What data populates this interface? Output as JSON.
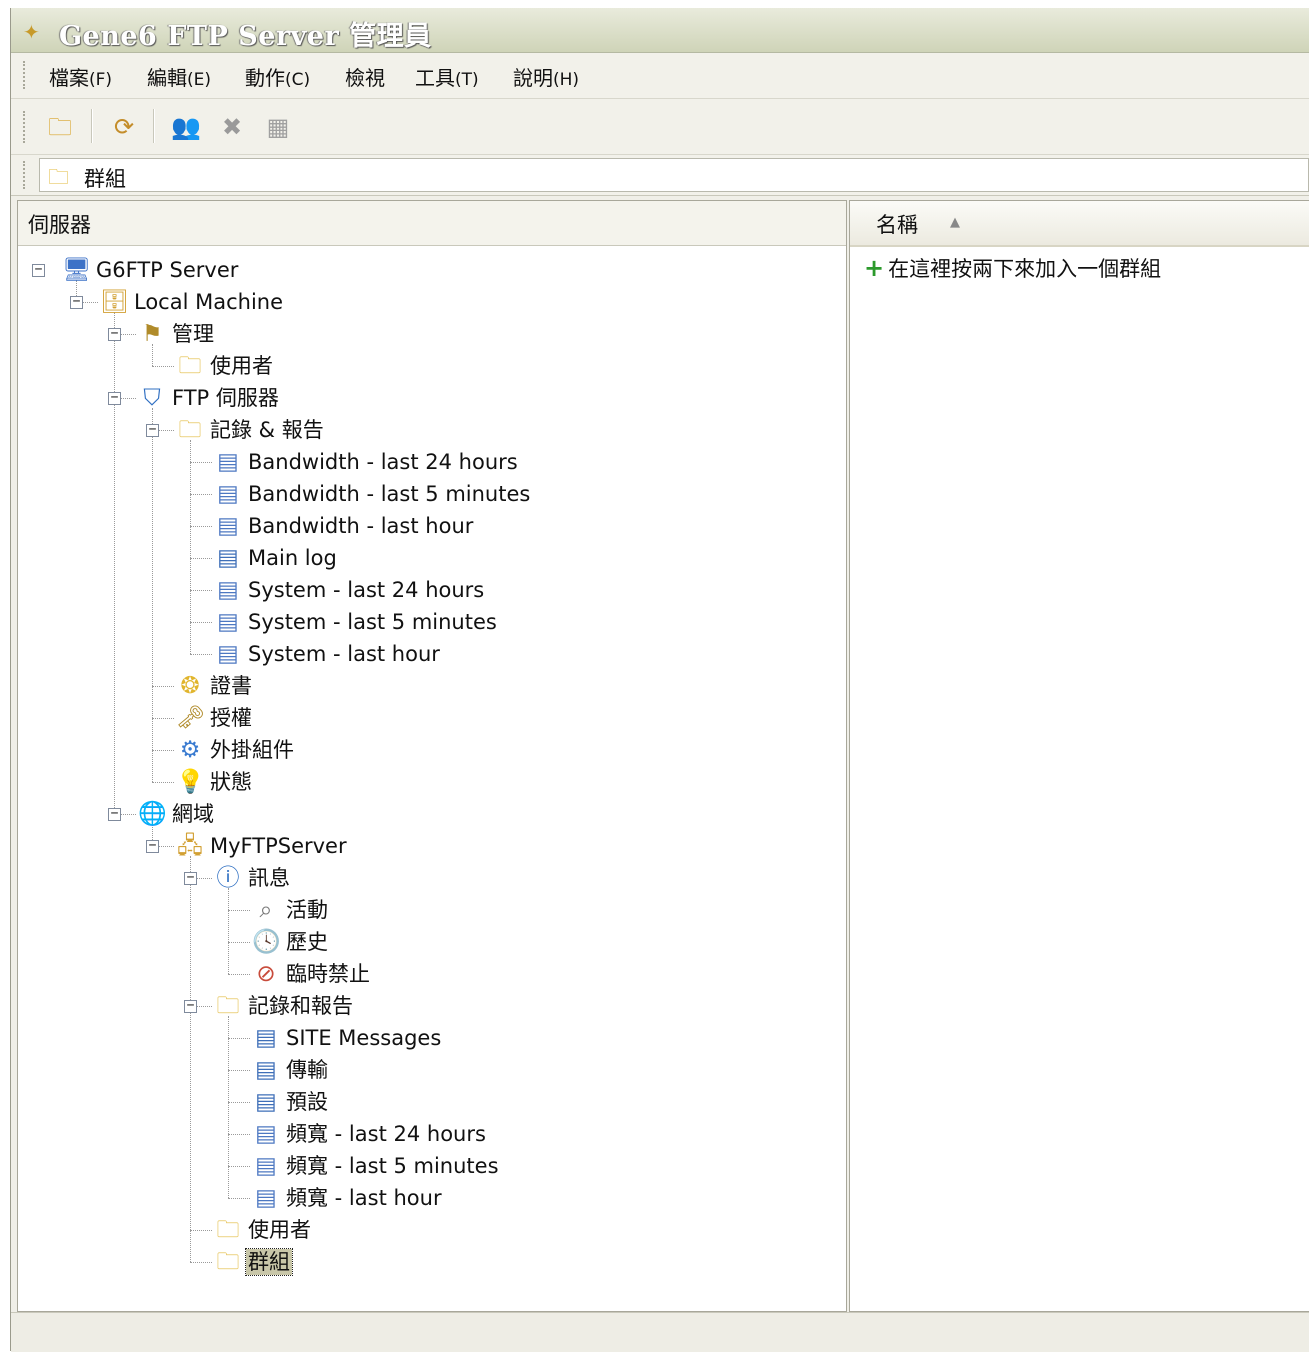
{
  "window": {
    "title": "Gene6 FTP Server 管理員"
  },
  "menu": [
    {
      "label": "檔案",
      "accel": "(F)"
    },
    {
      "label": "編輯",
      "accel": "(E)"
    },
    {
      "label": "動作",
      "accel": "(C)"
    },
    {
      "label": "檢視",
      "accel": ""
    },
    {
      "label": "工具",
      "accel": "(T)"
    },
    {
      "label": "說明",
      "accel": "(H)"
    }
  ],
  "toolbar": [
    "open-folder-icon",
    "refresh-icon",
    "users-icon",
    "delete-icon",
    "properties-icon"
  ],
  "address": {
    "text": "群組"
  },
  "left_pane": {
    "header": "伺服器"
  },
  "right_pane": {
    "column_name": "名稱",
    "add_row_text": "在這裡按兩下來加入一個群組"
  },
  "tree": [
    {
      "label": "G6FTP Server",
      "icon": "server-icon"
    },
    {
      "label": "Local Machine",
      "icon": "machine-icon"
    },
    {
      "label": "管理",
      "icon": "admin-icon"
    },
    {
      "label": "使用者",
      "icon": "folder-icon"
    },
    {
      "label": "FTP 伺服器",
      "icon": "shield-icon"
    },
    {
      "label": "記錄 & 報告",
      "icon": "folder-icon"
    },
    {
      "label": "Bandwidth - last 24 hours",
      "icon": "chart-doc-icon"
    },
    {
      "label": "Bandwidth - last 5 minutes",
      "icon": "chart-doc-icon"
    },
    {
      "label": "Bandwidth - last hour",
      "icon": "chart-doc-icon"
    },
    {
      "label": "Main log",
      "icon": "doc-icon"
    },
    {
      "label": "System - last 24 hours",
      "icon": "chart-doc-icon"
    },
    {
      "label": "System - last 5 minutes",
      "icon": "chart-doc-icon"
    },
    {
      "label": "System - last hour",
      "icon": "chart-doc-icon"
    },
    {
      "label": "證書",
      "icon": "certificate-icon"
    },
    {
      "label": "授權",
      "icon": "license-icon"
    },
    {
      "label": "外掛組件",
      "icon": "plugin-icon"
    },
    {
      "label": "狀態",
      "icon": "bulb-icon"
    },
    {
      "label": "網域",
      "icon": "globe-icon"
    },
    {
      "label": "MyFTPServer",
      "icon": "domain-server-icon"
    },
    {
      "label": "訊息",
      "icon": "info-icon"
    },
    {
      "label": "活動",
      "icon": "search-icon"
    },
    {
      "label": "歷史",
      "icon": "history-icon"
    },
    {
      "label": "臨時禁止",
      "icon": "ban-icon"
    },
    {
      "label": "記錄和報告",
      "icon": "folder-icon"
    },
    {
      "label": "SITE Messages",
      "icon": "doc-icon"
    },
    {
      "label": "傳輸",
      "icon": "doc-icon"
    },
    {
      "label": "預設",
      "icon": "doc-icon"
    },
    {
      "label": "頻寬 - last 24 hours",
      "icon": "chart-doc-icon"
    },
    {
      "label": "頻寬 - last 5 minutes",
      "icon": "chart-doc-icon"
    },
    {
      "label": "頻寬 - last hour",
      "icon": "chart-doc-icon"
    },
    {
      "label": "使用者",
      "icon": "folder-icon"
    },
    {
      "label": "群組",
      "icon": "folder-icon",
      "selected": true
    }
  ]
}
